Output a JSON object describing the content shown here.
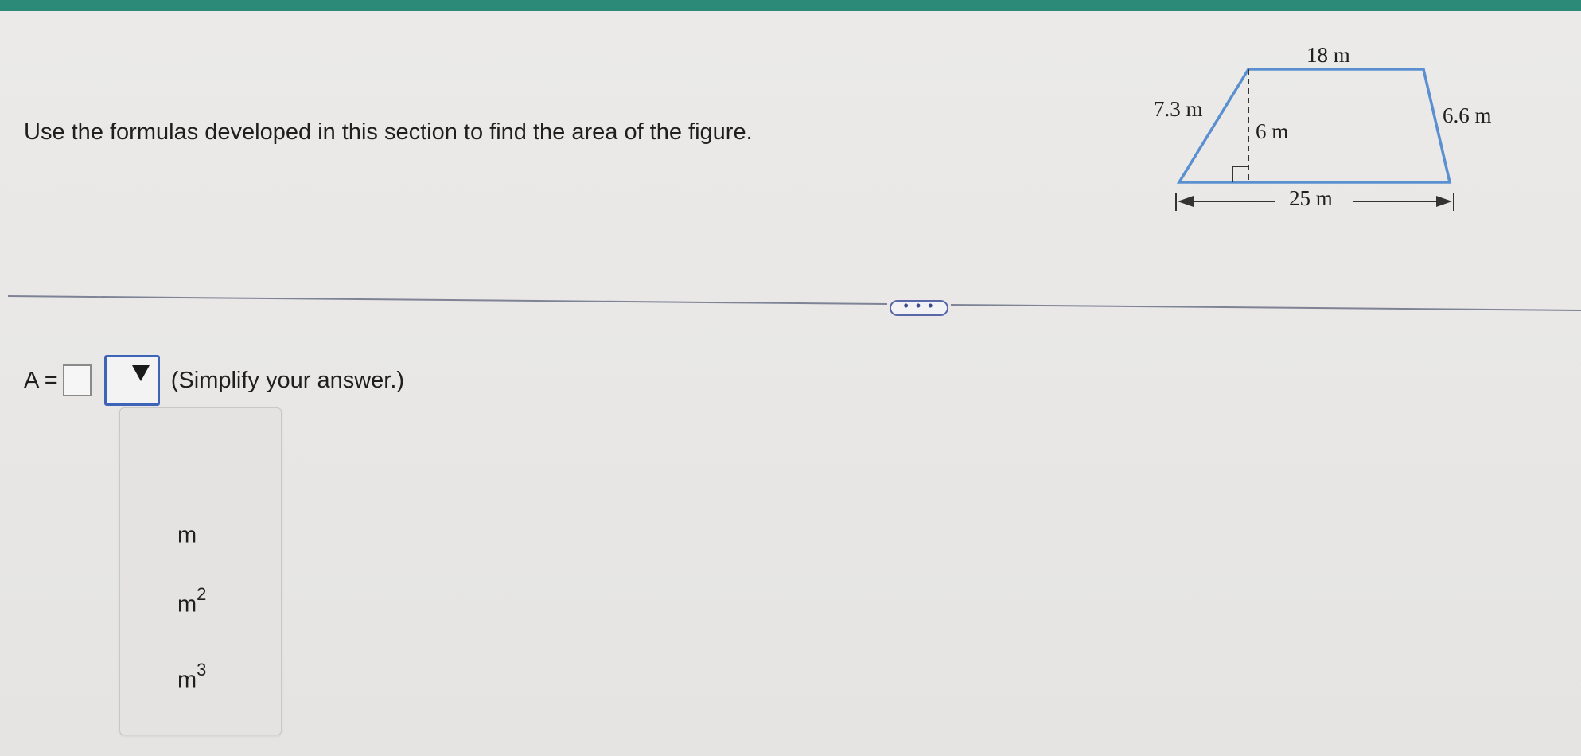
{
  "header": {
    "accent_color": "#2b8a78"
  },
  "question": {
    "text": "Use the formulas developed in this section to find the area of the figure."
  },
  "figure": {
    "shape": "trapezoid",
    "stroke_color": "#5a8fd0",
    "labels": {
      "top": "18 m",
      "left_side": "7.3 m",
      "right_side": "6.6 m",
      "height": "6 m",
      "bottom": "25 m"
    }
  },
  "divider": {
    "expand_label": "• • •"
  },
  "answer": {
    "label": "A =",
    "value": "",
    "hint": "(Simplify your answer.)",
    "dropdown_icon": "triangle-down-icon"
  },
  "dropdown": {
    "options": [
      {
        "base": "m",
        "exp": ""
      },
      {
        "base": "m",
        "exp": "2"
      },
      {
        "base": "m",
        "exp": "3"
      }
    ]
  }
}
